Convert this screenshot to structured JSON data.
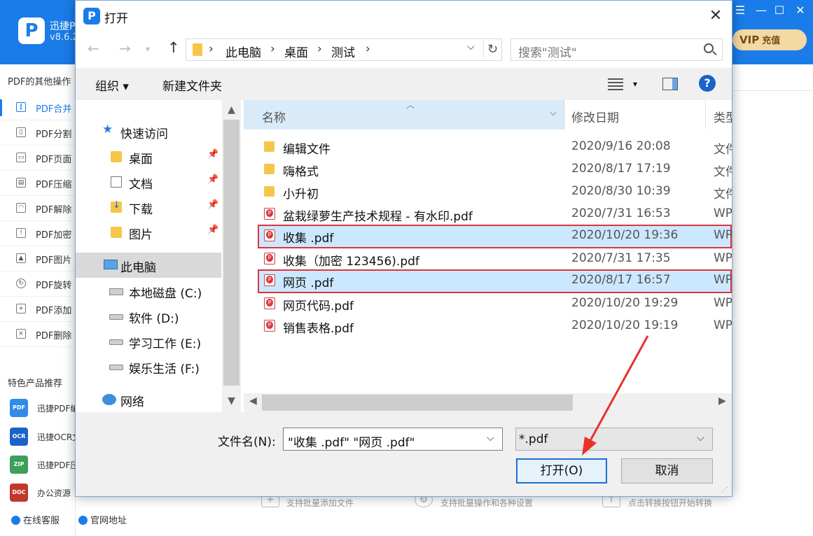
{
  "app": {
    "name": "迅捷PDF转换器",
    "version": "v8.6.2",
    "vip_label": "VIP",
    "vip_suffix": "充值",
    "other_ops_title": "PDF的其他操作",
    "sidebar_items": [
      {
        "label": "PDF合并"
      },
      {
        "label": "PDF分割"
      },
      {
        "label": "PDF页面"
      },
      {
        "label": "PDF压缩"
      },
      {
        "label": "PDF解除"
      },
      {
        "label": "PDF加密"
      },
      {
        "label": "PDF图片"
      },
      {
        "label": "PDF旋转"
      },
      {
        "label": "PDF添加"
      },
      {
        "label": "PDF删除"
      }
    ],
    "products_title": "特色产品推荐",
    "products": [
      {
        "label": "迅捷PDF编",
        "color": "#2f8be6",
        "tag": "PDF"
      },
      {
        "label": "迅捷OCR文",
        "color": "#1a63c9",
        "tag": "OCR"
      },
      {
        "label": "迅捷PDF压",
        "color": "#3aa05a",
        "tag": "ZIP"
      },
      {
        "label": "办公资源",
        "color": "#c0392b",
        "tag": "DOC"
      }
    ],
    "bottom_links": [
      "在线客服",
      "官网地址"
    ],
    "hints": [
      "支持批量添加文件",
      "支持批量操作和各种设置",
      "点击转换按钮开始转换"
    ]
  },
  "dialog": {
    "title": "打开",
    "breadcrumbs": [
      "此电脑",
      "桌面",
      "测试"
    ],
    "search_placeholder": "搜索\"测试\"",
    "toolbar": {
      "organize": "组织 ▾",
      "new_folder": "新建文件夹"
    },
    "tree": [
      {
        "label": "快速访问",
        "icon": "star-icon",
        "indent": 0
      },
      {
        "label": "桌面",
        "icon": "folder-icon",
        "indent": 1,
        "pinned": true
      },
      {
        "label": "文档",
        "icon": "document-icon",
        "indent": 1,
        "pinned": true
      },
      {
        "label": "下载",
        "icon": "download-icon",
        "indent": 1,
        "pinned": true
      },
      {
        "label": "图片",
        "icon": "folder-icon",
        "indent": 1,
        "pinned": true
      },
      {
        "label": "此电脑",
        "icon": "computer-icon",
        "indent": 0,
        "selected": true
      },
      {
        "label": "本地磁盘 (C:)",
        "icon": "drive-icon",
        "indent": 1
      },
      {
        "label": "软件 (D:)",
        "icon": "drive-icon",
        "indent": 1
      },
      {
        "label": "学习工作 (E:)",
        "icon": "drive-icon",
        "indent": 1
      },
      {
        "label": "娱乐生活 (F:)",
        "icon": "drive-icon",
        "indent": 1
      },
      {
        "label": "网络",
        "icon": "network-icon",
        "indent": 0
      }
    ],
    "columns": {
      "name": "名称",
      "date": "修改日期",
      "type": "类型"
    },
    "files": [
      {
        "name": "编辑文件",
        "date": "2020/9/16 20:08",
        "type": "文件夹",
        "kind": "folder"
      },
      {
        "name": "嗨格式",
        "date": "2020/8/17 17:19",
        "type": "文件夹",
        "kind": "folder"
      },
      {
        "name": "小升初",
        "date": "2020/8/30 10:39",
        "type": "文件夹",
        "kind": "folder"
      },
      {
        "name": "盆栽绿萝生产技术规程 - 有水印.pdf",
        "date": "2020/7/31 16:53",
        "type": "WPS PDF",
        "kind": "pdf"
      },
      {
        "name": "收集 .pdf",
        "date": "2020/10/20 19:36",
        "type": "WPS PDF",
        "kind": "pdf",
        "selected": true
      },
      {
        "name": "收集（加密 123456).pdf",
        "date": "2020/7/31 17:35",
        "type": "WPS PDF",
        "kind": "pdf"
      },
      {
        "name": "网页 .pdf",
        "date": "2020/8/17 16:57",
        "type": "WPS PDF",
        "kind": "pdf",
        "selected": true
      },
      {
        "name": "网页代码.pdf",
        "date": "2020/10/20 19:29",
        "type": "WPS PDF",
        "kind": "pdf"
      },
      {
        "name": "销售表格.pdf",
        "date": "2020/10/20 19:19",
        "type": "WPS PDF",
        "kind": "pdf"
      }
    ],
    "filename_label": "文件名(N):",
    "filename_value": "\"收集 .pdf\" \"网页 .pdf\"",
    "filter_value": "*.pdf",
    "open_button": "打开(O)",
    "cancel_button": "取消"
  },
  "colors": {
    "accent": "#1a7ce8",
    "highlight_border": "#d9363e",
    "selection": "#cce8ff"
  }
}
